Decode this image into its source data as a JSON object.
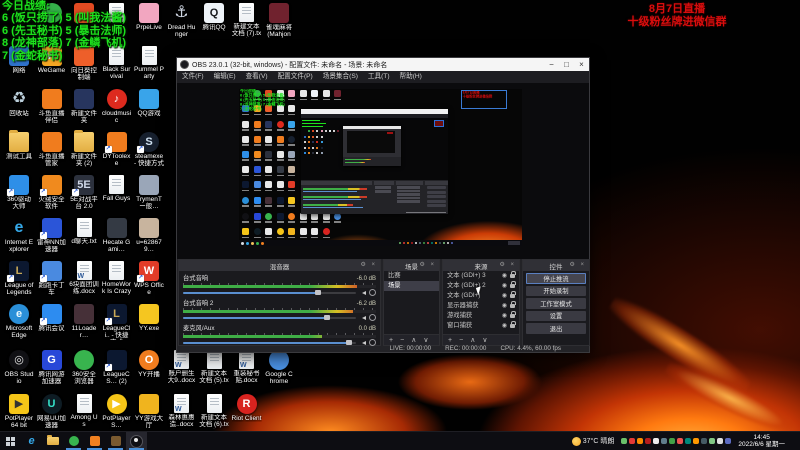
{
  "overlay_score": {
    "color": "#1de21d",
    "lines": [
      "今日战绩:",
      "6 (饭只捞了) 5 (叫我法酱)",
      "6 (先玉秘书) 5 (暴击法师)",
      "8 (龙神部落) 7 (金鳞飞机)",
      "7 (金蛇秘书)"
    ]
  },
  "overlay_announce": {
    "color": "#d90d0d",
    "lines": [
      "8月7日直播",
      "十级粉丝牌进微信群"
    ]
  },
  "desktop_icons": [
    {
      "r": 1,
      "c": 2,
      "label": "",
      "kind": "circle",
      "bg": "#35b04a"
    },
    {
      "r": 1,
      "c": 3,
      "label": "",
      "kind": "app",
      "bg": "#e34a22"
    },
    {
      "r": 1,
      "c": 4,
      "label": "",
      "kind": "paper"
    },
    {
      "r": 1,
      "c": 5,
      "label": "PrpeLive",
      "kind": "app",
      "bg": "#f2a6c0"
    },
    {
      "r": 1,
      "c": 6,
      "label": "Dread Hunger",
      "kind": "glyph",
      "glyph": "⚓",
      "glyph_color": "#cfd6e2"
    },
    {
      "r": 1,
      "c": 7,
      "label": "腾讯QQ",
      "kind": "app",
      "bg": "#eef3f8",
      "glyph": "Q",
      "glyph_color": "#16181c"
    },
    {
      "r": 1,
      "c": 8,
      "label": "新建文本文档 (7).txt",
      "kind": "paper"
    },
    {
      "r": 1,
      "c": 9,
      "label": "雀魂麻将 (Mahjong…",
      "kind": "app",
      "bg": "#70222e"
    },
    {
      "r": 2,
      "c": 1,
      "label": "网络",
      "kind": "app",
      "bg": "#2f72cc"
    },
    {
      "r": 2,
      "c": 2,
      "label": "WeGame",
      "kind": "app",
      "bg": "#f5a623",
      "glyph": "W",
      "glyph_color": "#ffffff"
    },
    {
      "r": 2,
      "c": 3,
      "label": "向日葵控制端",
      "kind": "app",
      "bg": "#ee5f2a"
    },
    {
      "r": 2,
      "c": 4,
      "label": "Black Survival",
      "kind": "paper"
    },
    {
      "r": 2,
      "c": 5,
      "label": "Pummel Party",
      "kind": "paper"
    },
    {
      "r": 3,
      "c": 1,
      "label": "回收站",
      "kind": "glyph",
      "glyph": "♻",
      "glyph_color": "#bcd0dc"
    },
    {
      "r": 3,
      "c": 2,
      "label": "斗鱼直播伴侣",
      "kind": "app",
      "bg": "#f07c1e"
    },
    {
      "r": 3,
      "c": 3,
      "label": "新建文件夹",
      "kind": "app",
      "bg": "#27355e"
    },
    {
      "r": 3,
      "c": 4,
      "label": "cloudmusic",
      "kind": "circle",
      "bg": "#dd2a1e",
      "glyph": "♪",
      "glyph_color": "#ffffff"
    },
    {
      "r": 3,
      "c": 5,
      "label": "QQ游戏",
      "kind": "app",
      "bg": "#39a4ea"
    },
    {
      "r": 4,
      "c": 1,
      "label": "测试工具",
      "kind": "folder"
    },
    {
      "r": 4,
      "c": 2,
      "label": "斗鱼直播管家",
      "kind": "app",
      "bg": "#f07c1e"
    },
    {
      "r": 4,
      "c": 3,
      "label": "新建文件夹 (2)",
      "kind": "folder"
    },
    {
      "r": 4,
      "c": 4,
      "label": "DYToolexe",
      "kind": "app",
      "bg": "#f07c1e",
      "shortcut": true
    },
    {
      "r": 4,
      "c": 5,
      "label": "steamexe - 快捷方式",
      "kind": "circle",
      "bg": "#17202e",
      "glyph": "S",
      "glyph_color": "#cfe0f0",
      "shortcut": true
    },
    {
      "r": 5,
      "c": 1,
      "label": "360驱动大师",
      "kind": "app",
      "bg": "#2e8fe8",
      "shortcut": true
    },
    {
      "r": 5,
      "c": 2,
      "label": "火绒安全软件",
      "kind": "app",
      "bg": "#f08a1e",
      "shortcut": true
    },
    {
      "r": 5,
      "c": 3,
      "label": "5E对战平台 2.0",
      "kind": "app",
      "bg": "#2c313d",
      "glyph": "5E",
      "glyph_color": "#cfd8e8",
      "shortcut": true
    },
    {
      "r": 5,
      "c": 4,
      "label": "Fall Guys",
      "kind": "paper"
    },
    {
      "r": 5,
      "c": 5,
      "label": "TrymenT ー般…",
      "kind": "app",
      "bg": "#9aa6b8"
    },
    {
      "r": 6,
      "c": 1,
      "label": "Internet Explorer",
      "kind": "glyph",
      "glyph": "e",
      "glyph_color": "#35a8e8"
    },
    {
      "r": 6,
      "c": 2,
      "label": "雷神NN加速器",
      "kind": "app",
      "bg": "#2b55d8",
      "shortcut": true
    },
    {
      "r": 6,
      "c": 3,
      "label": "d聊天.txt",
      "kind": "paper"
    },
    {
      "r": 6,
      "c": 4,
      "label": "Hecate Gami…",
      "kind": "app",
      "bg": "#343a44"
    },
    {
      "r": 6,
      "c": 5,
      "label": "u=628679…",
      "kind": "app",
      "bg": "#c8b49e"
    },
    {
      "r": 7,
      "c": 1,
      "label": "League of Legends",
      "kind": "app",
      "bg": "#0c1830",
      "glyph": "L",
      "glyph_color": "#c8a858",
      "shortcut": true
    },
    {
      "r": 7,
      "c": 2,
      "label": "跑跑卡丁车",
      "kind": "app",
      "bg": "#4a8ae0",
      "shortcut": true
    },
    {
      "r": 7,
      "c": 3,
      "label": "6块面团训练.docx",
      "kind": "docx"
    },
    {
      "r": 7,
      "c": 4,
      "label": "HomeWork Is Crazy",
      "kind": "paper"
    },
    {
      "r": 7,
      "c": 5,
      "label": "WPS Office",
      "kind": "app",
      "bg": "#e23c28",
      "glyph": "W",
      "glyph_color": "#ffffff",
      "shortcut": true
    },
    {
      "r": 8,
      "c": 1,
      "label": "Microsoft Edge",
      "kind": "circle",
      "bg": "#2a8fd8",
      "glyph": "e",
      "glyph_color": "#e8f8ff"
    },
    {
      "r": 8,
      "c": 2,
      "label": "腾讯会议",
      "kind": "app",
      "bg": "#2d8cf0",
      "shortcut": true
    },
    {
      "r": 8,
      "c": 3,
      "label": "11Loader…",
      "kind": "app",
      "bg": "#463038"
    },
    {
      "r": 8,
      "c": 4,
      "label": "LeagueCli.. - 快捷方式",
      "kind": "app",
      "bg": "#0c1830",
      "glyph": "L",
      "glyph_color": "#c8a858",
      "shortcut": true
    },
    {
      "r": 8,
      "c": 5,
      "label": "YY.exe",
      "kind": "app",
      "bg": "#f5c620"
    },
    {
      "r": 9,
      "c": 1,
      "label": "OBS Studio",
      "kind": "circle",
      "bg": "#101014",
      "glyph": "◎",
      "glyph_color": "#e8e8e8"
    },
    {
      "r": 9,
      "c": 2,
      "label": "腾讯网游加速器",
      "kind": "app",
      "bg": "#2848d8",
      "glyph": "G",
      "glyph_color": "#ffffff"
    },
    {
      "r": 9,
      "c": 3,
      "label": "360安全浏览器",
      "kind": "circle",
      "bg": "#38b44e"
    },
    {
      "r": 9,
      "c": 4,
      "label": "LeagueCS… (2)",
      "kind": "app",
      "bg": "#0c1830",
      "shortcut": true
    },
    {
      "r": 9,
      "c": 5,
      "label": "YY开播",
      "kind": "circle",
      "bg": "#f07c1e",
      "glyph": "O",
      "glyph_color": "#ffffff"
    },
    {
      "r": 9,
      "c": 6,
      "label": "账户删生大9..docx",
      "kind": "docx"
    },
    {
      "r": 9,
      "c": 7,
      "label": "新建文本文档 (5).txt",
      "kind": "paper"
    },
    {
      "r": 9,
      "c": 8,
      "label": "重装秘书贴.docx",
      "kind": "docx"
    },
    {
      "r": 9,
      "c": 9,
      "label": "Google Chrome",
      "kind": "circle",
      "bg": "#4a90e2"
    },
    {
      "r": 10,
      "c": 1,
      "label": "PotPlayer 64 bit",
      "kind": "app",
      "bg": "#f5c518",
      "glyph": "▶",
      "glyph_color": "#333333"
    },
    {
      "r": 10,
      "c": 2,
      "label": "网易UU加速器",
      "kind": "circle",
      "bg": "#0e1c24",
      "glyph": "U",
      "glyph_color": "#35e0c8"
    },
    {
      "r": 10,
      "c": 3,
      "label": "Among Us",
      "kind": "paper"
    },
    {
      "r": 10,
      "c": 4,
      "label": "PotPlayerS…",
      "kind": "circle",
      "bg": "#f5c518",
      "glyph": "▶",
      "glyph_color": "#ffffff"
    },
    {
      "r": 10,
      "c": 5,
      "label": "YY游戏大厅",
      "kind": "app",
      "bg": "#f0b41e"
    },
    {
      "r": 10,
      "c": 6,
      "label": "森林惠惠造..docx",
      "kind": "docx"
    },
    {
      "r": 10,
      "c": 7,
      "label": "新建文本文档 (6).txt",
      "kind": "paper"
    },
    {
      "r": 10,
      "c": 8,
      "label": "Riot Client",
      "kind": "circle",
      "bg": "#d8231f",
      "glyph": "R",
      "glyph_color": "#ffffff"
    }
  ],
  "obs": {
    "window_title": "OBS 23.0.1 (32-bit, windows) - 配置文件: 未命名 - 场景: 未命名",
    "window_buttons": [
      "−",
      "□",
      "×"
    ],
    "menu": [
      "文件(F)",
      "编辑(E)",
      "查看(V)",
      "配置文件(P)",
      "场景集合(S)",
      "工具(T)",
      "帮助(H)"
    ],
    "mixer": {
      "title": "混音器",
      "tracks": [
        {
          "name": "台式音响",
          "db": "-6.0 dB",
          "meter_pct": 90,
          "slider_pct": 78
        },
        {
          "name": "台式音响 2",
          "db": "-6.2 dB",
          "meter_pct": 88,
          "slider_pct": 83
        },
        {
          "name": "麦克风/Aux",
          "db": "0.0 dB",
          "meter_pct": 72,
          "slider_pct": 96
        }
      ]
    },
    "scenes": {
      "title": "场景",
      "items": [
        "比赛",
        "场景"
      ],
      "selected_index": 1,
      "toolbar": [
        "+",
        "−",
        "∧",
        "∨"
      ]
    },
    "sources": {
      "title": "来源",
      "items": [
        "文本 (GDI+) 3",
        "文本 (GDI+) 2",
        "文本 (GDI+)",
        "显示器捕获",
        "游戏捕获",
        "窗口捕获"
      ],
      "toolbar": [
        "+",
        "−",
        "∧",
        "∨"
      ]
    },
    "controls": {
      "title": "控件",
      "buttons": [
        "停止推流",
        "开始录制",
        "工作室模式",
        "设置",
        "退出"
      ],
      "active_index": 0
    },
    "status": {
      "live": "LIVE: 00:00:00",
      "rec": "REC: 00:00:00",
      "cpu": "CPU: 4.4%, 60.00 fps"
    },
    "panel_header_icons": "⚙ ×"
  },
  "taskbar": {
    "apps": [
      {
        "name": "start",
        "kind": "win"
      },
      {
        "name": "internet-explorer",
        "kind": "letter",
        "letter": "e",
        "color": "#35a8e8"
      },
      {
        "name": "file-explorer",
        "kind": "folder"
      },
      {
        "name": "360-app",
        "kind": "dot",
        "color": "#38b44e",
        "running": true
      },
      {
        "name": "orange-app",
        "kind": "sq",
        "color": "#f08020",
        "running": true
      },
      {
        "name": "game-app",
        "kind": "sq",
        "color": "#7a5a30",
        "running": true
      },
      {
        "name": "obs-studio",
        "kind": "obs",
        "running": true,
        "active": true
      }
    ],
    "tray": {
      "weather_temp": "37°C",
      "weather_desc": "晴朗",
      "icons": [
        "#6abf69",
        "#e53935",
        "#fb8c00",
        "#b71c1c",
        "#ececec",
        "#607d8b",
        "#43a047",
        "#ef5350",
        "#00897b",
        "#ff9800",
        "#455a64",
        "#81c784",
        "#e0e0e0",
        "#5c6bc0"
      ],
      "time": "14:45",
      "date": "2022/6/6 星期一"
    }
  }
}
